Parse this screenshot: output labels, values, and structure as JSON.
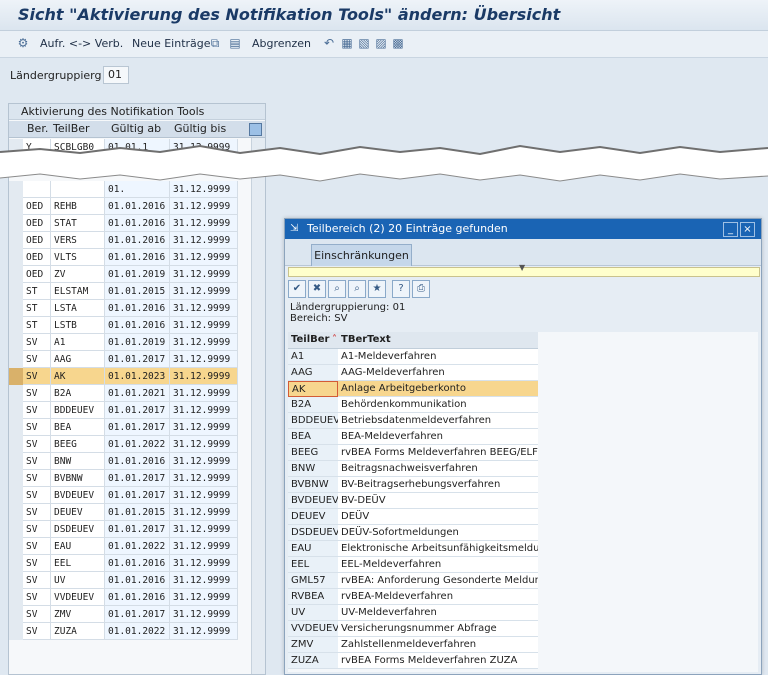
{
  "title": "Sicht \"Aktivierung des Notifikation Tools\" ändern: Übersicht",
  "toolbar": {
    "items": [
      "Aufr. <-> Verb.",
      "Neue Einträge",
      "Abgrenzen"
    ]
  },
  "header": {
    "field_label": "Ländergruppierg",
    "field_value": "01"
  },
  "table": {
    "caption": "Aktivierung des Notifikation Tools",
    "columns": [
      "Ber.",
      "TeilBer",
      "Gültig ab",
      "Gültig bis"
    ],
    "top_row": [
      "Y",
      "SCBLGB0",
      "01.01.1",
      "31.12.9999"
    ],
    "fragment_row": [
      "",
      "",
      "01.",
      "31.12.9999"
    ],
    "rows": [
      [
        "OED",
        "REHB",
        "01.01.2016",
        "31.12.9999"
      ],
      [
        "OED",
        "STAT",
        "01.01.2016",
        "31.12.9999"
      ],
      [
        "OED",
        "VERS",
        "01.01.2016",
        "31.12.9999"
      ],
      [
        "OED",
        "VLTS",
        "01.01.2016",
        "31.12.9999"
      ],
      [
        "OED",
        "ZV",
        "01.01.2019",
        "31.12.9999"
      ],
      [
        "ST",
        "ELSTAM",
        "01.01.2015",
        "31.12.9999"
      ],
      [
        "ST",
        "LSTA",
        "01.01.2016",
        "31.12.9999"
      ],
      [
        "ST",
        "LSTB",
        "01.01.2016",
        "31.12.9999"
      ],
      [
        "SV",
        "A1",
        "01.01.2019",
        "31.12.9999"
      ],
      [
        "SV",
        "AAG",
        "01.01.2017",
        "31.12.9999"
      ],
      [
        "SV",
        "AK",
        "01.01.2023",
        "31.12.9999"
      ],
      [
        "SV",
        "B2A",
        "01.01.2021",
        "31.12.9999"
      ],
      [
        "SV",
        "BDDEUEV",
        "01.01.2017",
        "31.12.9999"
      ],
      [
        "SV",
        "BEA",
        "01.01.2017",
        "31.12.9999"
      ],
      [
        "SV",
        "BEEG",
        "01.01.2022",
        "31.12.9999"
      ],
      [
        "SV",
        "BNW",
        "01.01.2016",
        "31.12.9999"
      ],
      [
        "SV",
        "BVBNW",
        "01.01.2017",
        "31.12.9999"
      ],
      [
        "SV",
        "BVDEUEV",
        "01.01.2017",
        "31.12.9999"
      ],
      [
        "SV",
        "DEUEV",
        "01.01.2015",
        "31.12.9999"
      ],
      [
        "SV",
        "DSDEUEV",
        "01.01.2017",
        "31.12.9999"
      ],
      [
        "SV",
        "EAU",
        "01.01.2022",
        "31.12.9999"
      ],
      [
        "SV",
        "EEL",
        "01.01.2016",
        "31.12.9999"
      ],
      [
        "SV",
        "UV",
        "01.01.2016",
        "31.12.9999"
      ],
      [
        "SV",
        "VVDEUEV",
        "01.01.2016",
        "31.12.9999"
      ],
      [
        "SV",
        "ZMV",
        "01.01.2017",
        "31.12.9999"
      ],
      [
        "SV",
        "ZUZA",
        "01.01.2022",
        "31.12.9999"
      ]
    ]
  },
  "popup": {
    "title": "Teilbereich (2)   20 Einträge gefunden",
    "tab": "Einschränkungen",
    "info": [
      "Ländergruppierung: 01",
      "Bereich: SV"
    ],
    "columns": [
      "TeilBer",
      "TBerText"
    ],
    "rows": [
      [
        "A1",
        "A1-Meldeverfahren"
      ],
      [
        "AAG",
        "AAG-Meldeverfahren"
      ],
      [
        "AK",
        "Anlage Arbeitgeberkonto"
      ],
      [
        "B2A",
        "Behördenkommunikation"
      ],
      [
        "BDDEUEV",
        "Betriebsdatenmeldeverfahren"
      ],
      [
        "BEA",
        "BEA-Meldeverfahren"
      ],
      [
        "BEEG",
        "rvBEA Forms Meldeverfahren BEEG/ELFE"
      ],
      [
        "BNW",
        "Beitragsnachweisverfahren"
      ],
      [
        "BVBNW",
        "BV-Beitragserhebungsverfahren"
      ],
      [
        "BVDEUEV",
        "BV-DEÜV"
      ],
      [
        "DEUEV",
        "DEÜV"
      ],
      [
        "DSDEUEV",
        "DEÜV-Sofortmeldungen"
      ],
      [
        "EAU",
        "Elektronische Arbeitsunfähigkeitsmeldung"
      ],
      [
        "EEL",
        "EEL-Meldeverfahren"
      ],
      [
        "GML57",
        "rvBEA: Anforderung Gesonderte Meldung"
      ],
      [
        "RVBEA",
        "rvBEA-Meldeverfahren"
      ],
      [
        "UV",
        "UV-Meldeverfahren"
      ],
      [
        "VVDEUEV",
        "Versicherungsnummer Abfrage"
      ],
      [
        "ZMV",
        "Zahlstellenmeldeverfahren"
      ],
      [
        "ZUZA",
        "rvBEA Forms Meldeverfahren ZUZA"
      ]
    ]
  }
}
